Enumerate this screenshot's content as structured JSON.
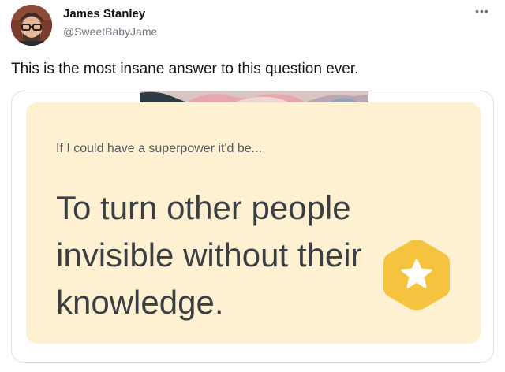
{
  "tweet": {
    "author": {
      "display_name": "James Stanley",
      "handle": "@SweetBabyJame"
    },
    "more_icon": "ellipsis-icon",
    "text": "This is the most insane answer to this question ever."
  },
  "card": {
    "prompt": "If I could have a superpower it'd be...",
    "answer": "To turn other people invisible without their knowledge.",
    "badge_icon": "star-hexagon-icon",
    "colors": {
      "card_background": "#fdf1d2",
      "badge": "#f6c33f",
      "answer_text": "#3b3f44"
    }
  }
}
